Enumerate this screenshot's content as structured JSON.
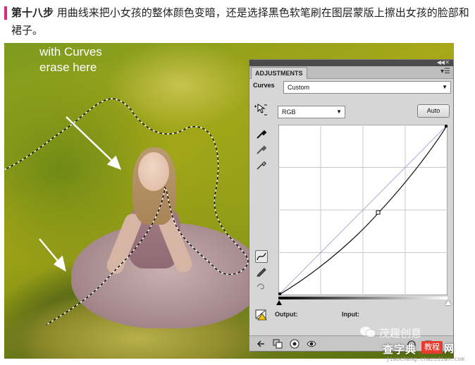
{
  "article": {
    "step_title": "第十八步",
    "step_text": "用曲线来把小女孩的整体颜色变暗，还是选择黑色软笔刷在图层蒙版上擦出女孩的脸部和裙子。",
    "accent_color": "#e0287a"
  },
  "photo": {
    "annotation_line1": "with Curves",
    "annotation_line2": "erase here"
  },
  "panel": {
    "tab_label": "ADJUSTMENTS",
    "curves_label": "Curves",
    "preset_value": "Custom",
    "channel_value": "RGB",
    "auto_button": "Auto",
    "output_label": "Output:",
    "input_label": "Input:",
    "icons": [
      "target-adjust-icon",
      "eyedropper-black-icon",
      "eyedropper-gray-icon",
      "eyedropper-white-icon",
      "curve-point-icon",
      "pencil-icon",
      "smooth-icon",
      "clipping-warning-icon",
      "back-arrow-icon",
      "clip-layer-icon",
      "visibility-eye-icon",
      "previous-state-icon",
      "reset-icon"
    ]
  },
  "watermark": {
    "wechat_text": "茂趣创意",
    "site_name": "查字典",
    "badge": "教程",
    "net": "网",
    "url": "jiaocheng.chazidian.com"
  }
}
